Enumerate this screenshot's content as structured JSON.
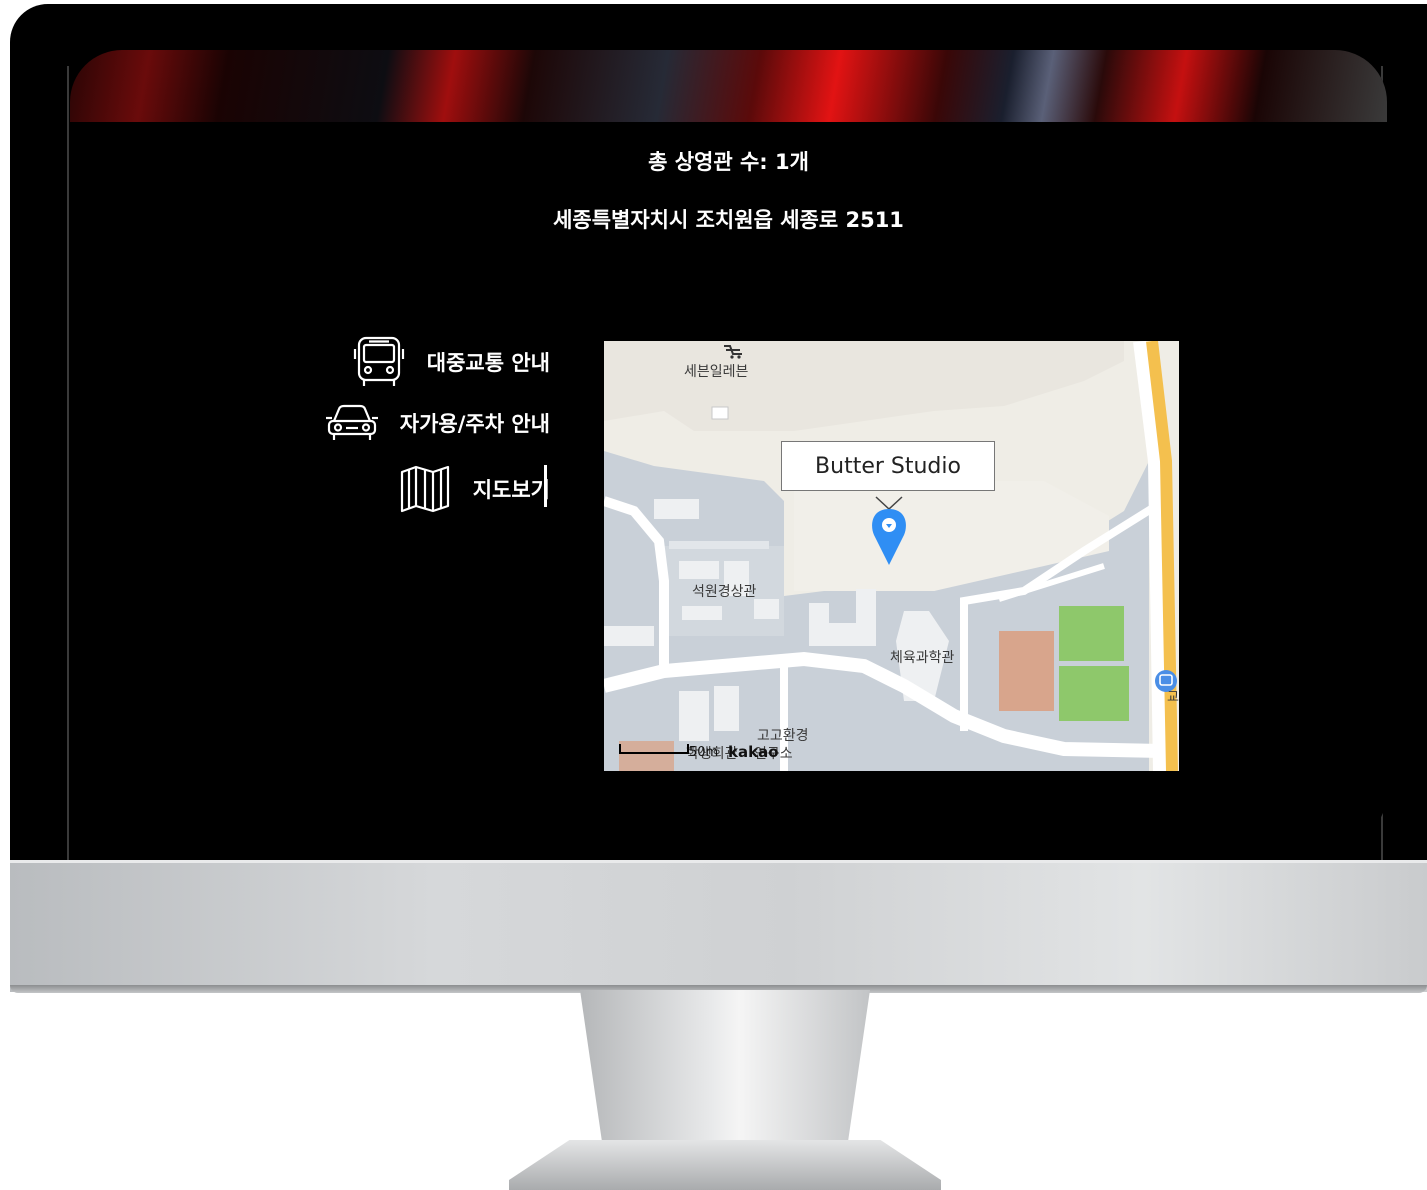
{
  "theater": {
    "screen_count": "총 상영관 수: 1개",
    "address": "세종특별자치시 조치원읍 세종로 2511"
  },
  "menu": {
    "items": [
      {
        "label": "대중교통 안내",
        "icon": "bus-icon"
      },
      {
        "label": "자가용/주차 안내",
        "icon": "car-icon"
      },
      {
        "label": "지도보기",
        "icon": "map-icon",
        "active": true
      }
    ]
  },
  "map": {
    "marker_title": "Butter Studio",
    "labels": {
      "store": "세븐일레븐",
      "building1": "석원경상관",
      "building2": "체육과학관",
      "building3a": "고고환경",
      "building3b": "학생회관",
      "building3c": "연구소",
      "road_sign": "교"
    },
    "scale": "50m",
    "provider": "kakao",
    "colors": {
      "road": "#ffffff",
      "highway": "#f4c04e",
      "building": "#cfd6dd",
      "ground": "#efede6",
      "campus": "#c7ced6",
      "marker": "#2f8ef4",
      "court_green": "#8ec86b",
      "court_brown": "#d8a58c"
    }
  }
}
